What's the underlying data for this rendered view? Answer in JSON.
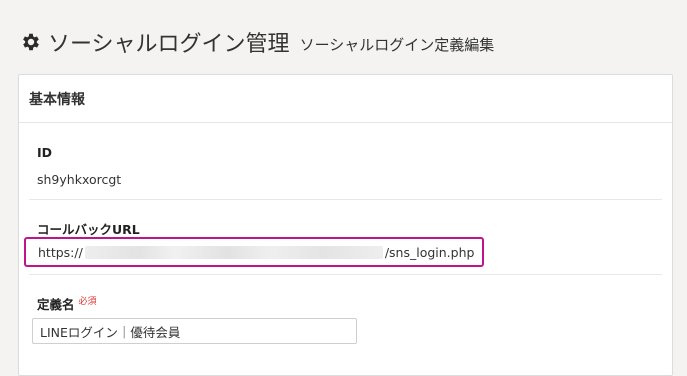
{
  "header": {
    "title": "ソーシャルログイン管理",
    "subtitle": "ソーシャルログイン定義編集",
    "icon": "gear-icon"
  },
  "panel": {
    "title": "基本情報",
    "id_field": {
      "label": "ID",
      "value": "sh9yhkxorcgt"
    },
    "callback_field": {
      "label": "コールバックURL",
      "prefix": "https://",
      "suffix": "/sns_login.php",
      "highlight_color": "#c0148c"
    },
    "name_field": {
      "label": "定義名",
      "required": "必須",
      "value": "LINEログイン｜優待会員"
    }
  }
}
